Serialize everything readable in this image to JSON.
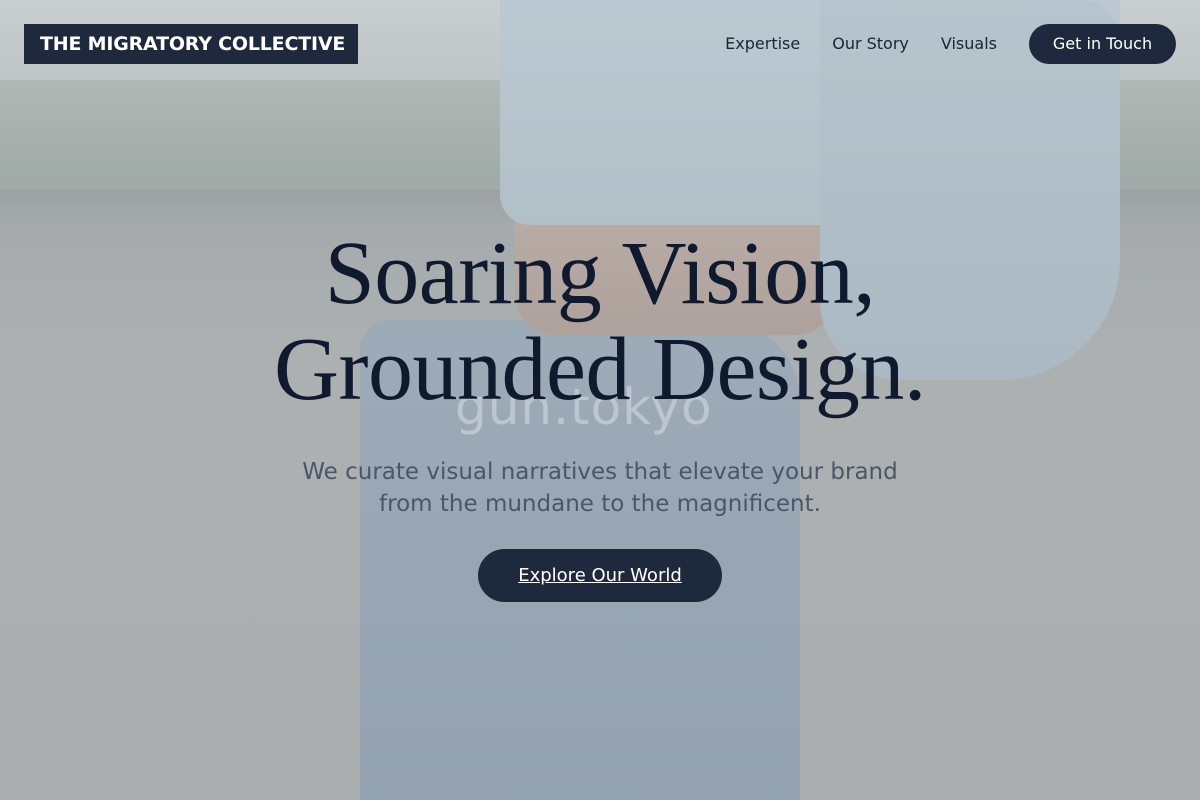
{
  "brand": {
    "name": "THE MIGRATORY COLLECTIVE"
  },
  "nav": {
    "links": [
      "Expertise",
      "Our Story",
      "Visuals"
    ],
    "cta": "Get in Touch"
  },
  "hero": {
    "headline_line1": "Soaring Vision,",
    "headline_line2": "Grounded Design.",
    "subtitle_line1": "We curate visual narratives that elevate your brand",
    "subtitle_line2": "from the mundane to the magnificent.",
    "button": "Explore Our World"
  },
  "background": {
    "description_icon": "fashion-photo-background",
    "watermark": "gun.tokyo"
  },
  "colors": {
    "primary_dark": "#1f293d",
    "headline": "#0f1a2e",
    "subtitle": "#4a5669",
    "button_text": "#ffffff"
  }
}
